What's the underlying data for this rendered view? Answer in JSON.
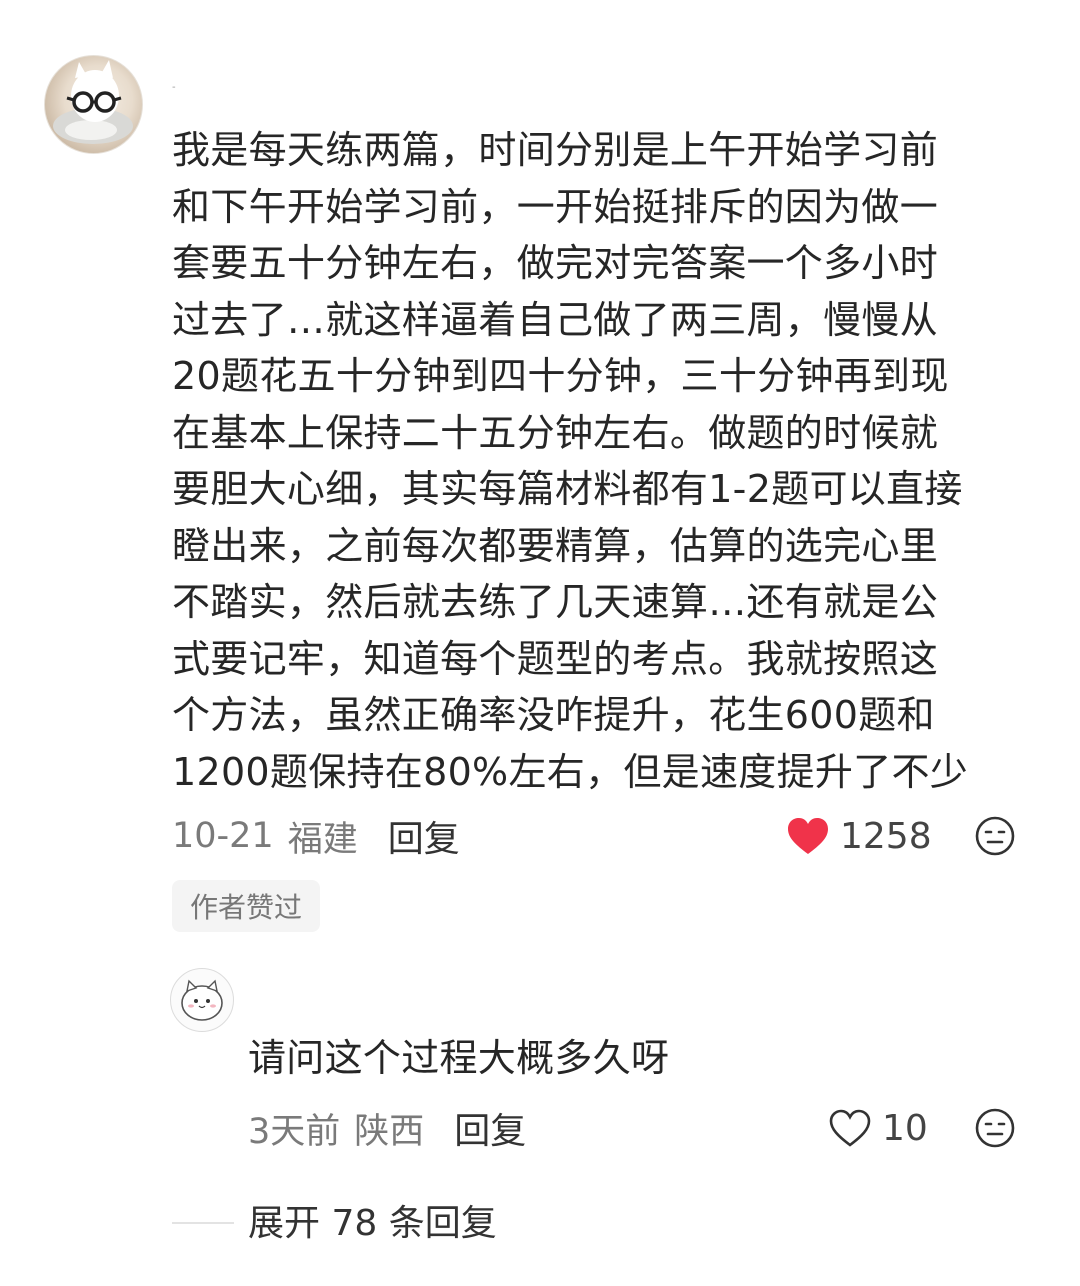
{
  "comment": {
    "avatar_icon": "avatar-cat-with-glasses-icon",
    "username": "-",
    "text": "我是每天练两篇，时间分别是上午开始学习前\n和下午开始学习前，一开始挺排斥的因为做一\n套要五十分钟左右，做完对完答案一个多小时\n过去了…就这样逼着自己做了两三周，慢慢从\n20题花五十分钟到四十分钟，三十分钟再到现\n在基本上保持二十五分钟左右。做题的时候就\n要胆大心细，其实每篇材料都有1-2题可以直接\n瞪出来，之前每次都要精算，估算的选完心里\n不踏实，然后就去练了几天速算…还有就是公\n式要记牢，知道每个题型的考点。我就按照这\n个方法，虽然正确率没咋提升，花生600题和\n1200题保持在80%左右，但是速度提升了不少",
    "date": "10-21",
    "region": "福建",
    "reply_label": "回复",
    "like_count": "1258",
    "like_icon": "heart-filled-icon",
    "like_color": "#f0334a",
    "emoji_icon": "emoji-icon",
    "author_badge": "作者赞过"
  },
  "reply": {
    "avatar_icon": "avatar-cartoon-cat-icon",
    "text": "请问这个过程大概多久呀",
    "date": "3天前",
    "region": "陕西",
    "reply_label": "回复",
    "like_count": "10",
    "like_icon": "heart-outline-icon",
    "emoji_icon": "emoji-icon"
  },
  "expand": {
    "label": "展开 78 条回复"
  }
}
